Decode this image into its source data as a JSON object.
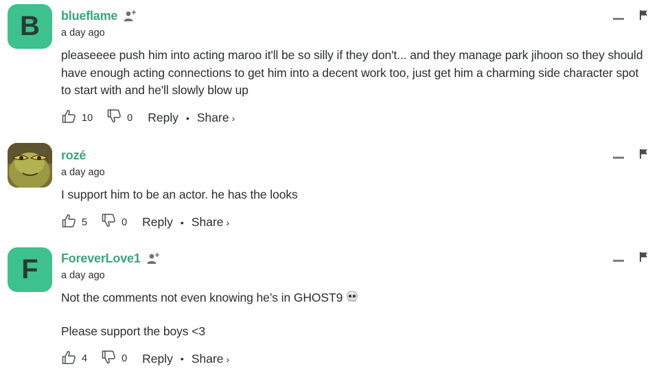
{
  "comments": [
    {
      "avatar_letter": "B",
      "username": "blueflame",
      "timestamp": "a day ago",
      "text": [
        "pleaseeee push him into acting maroo it'll be so silly if they don't... and they manage park jihoon so they should have enough acting connections to get him into a decent work too, just get him a charming side character spot to start with and he'll slowly blow up"
      ],
      "upvotes": "10",
      "downvotes": "0",
      "reply_label": "Reply",
      "share_label": "Share",
      "follow_icon": "add-user-icon"
    },
    {
      "avatar_letter": "",
      "username": "rozé",
      "timestamp": "a day ago",
      "text": [
        "I support him to be an actor. he has the looks"
      ],
      "upvotes": "5",
      "downvotes": "0",
      "reply_label": "Reply",
      "share_label": "Share"
    },
    {
      "avatar_letter": "F",
      "username": "ForeverLove1",
      "timestamp": "a day ago",
      "text": [
        "Not the comments not even knowing he’s in GHOST9",
        "Please support the boys <3"
      ],
      "upvotes": "4",
      "downvotes": "0",
      "reply_label": "Reply",
      "share_label": "Share",
      "emoji_icon": "skull-icon",
      "follow_icon": "add-user-icon"
    }
  ],
  "colors": {
    "accent": "#3aa779",
    "avatar_bg": "#3cc18f",
    "text": "#2a2e2e"
  }
}
